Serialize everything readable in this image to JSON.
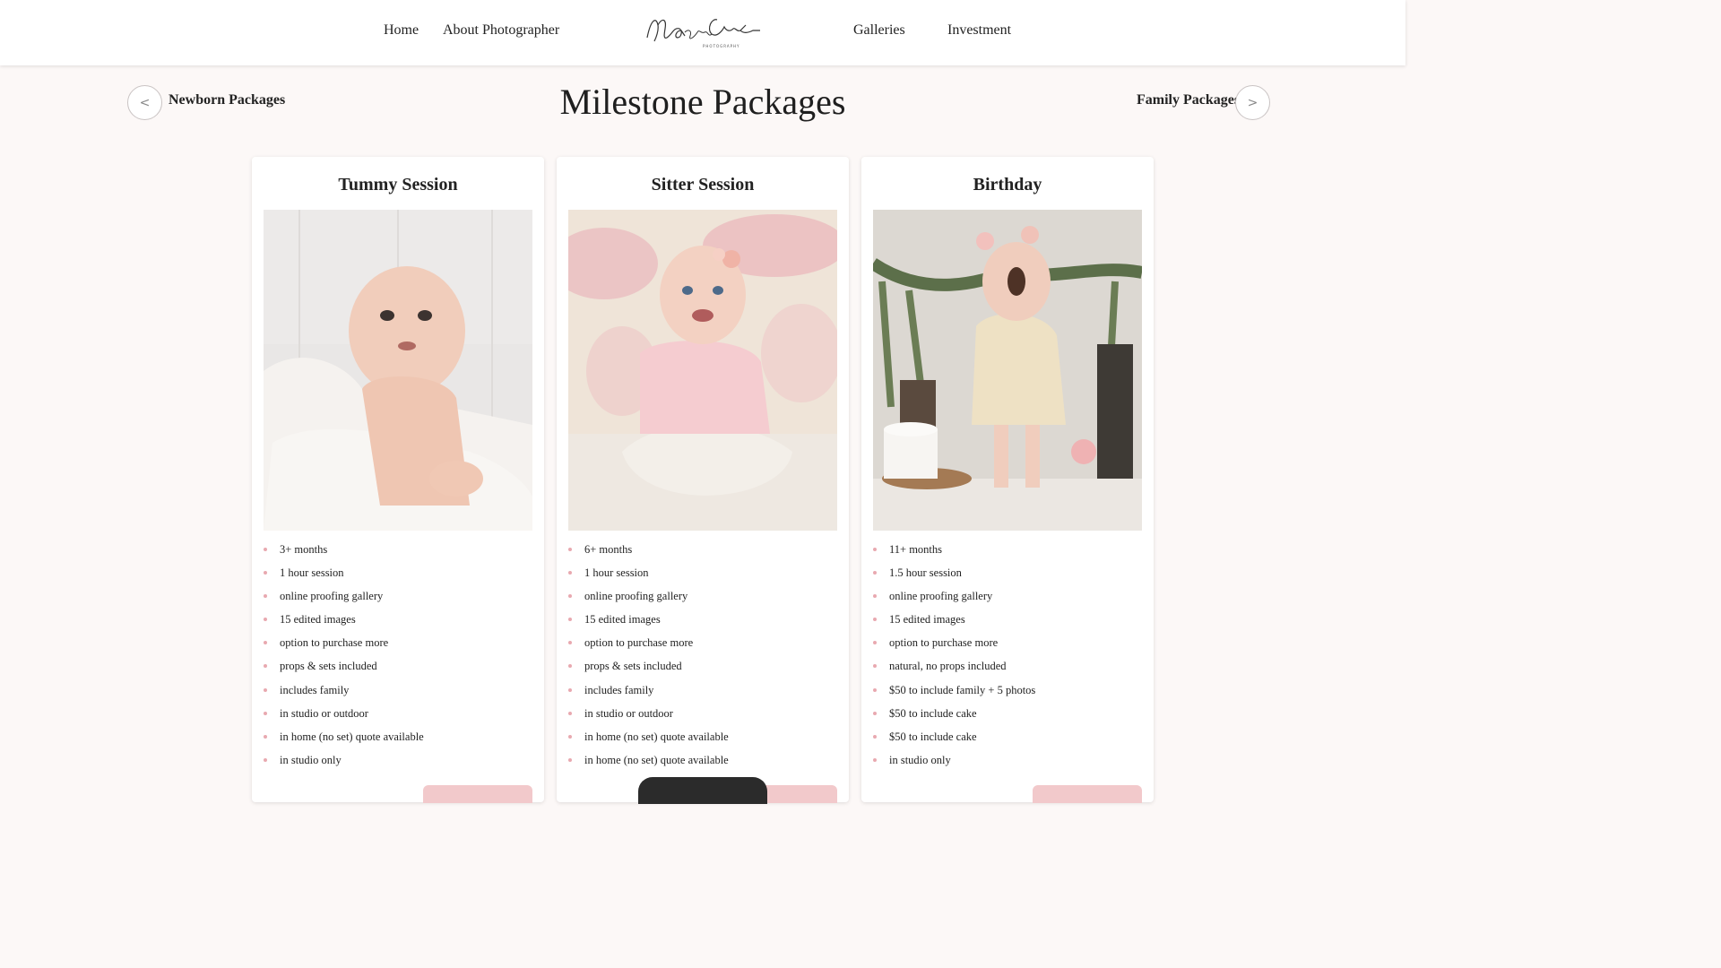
{
  "nav": {
    "home": "Home",
    "about": "About Photographer",
    "galleries": "Galleries",
    "investment": "Investment"
  },
  "logo": {
    "text": "Magnolia Coasts",
    "subtext": "PHOTOGRAPHY"
  },
  "subnav": {
    "prev_label": "Newborn Packages",
    "prev_icon": "<",
    "next_label": "Family Packages",
    "next_icon": ">"
  },
  "page_title": "Milestone Packages",
  "colors": {
    "accent": "#f2c9cb",
    "bullet": "#e8a9b0",
    "background": "#fcf8f7"
  },
  "cards": [
    {
      "title": "Tummy Session",
      "features": [
        "3+ months",
        "1 hour session",
        "online proofing gallery",
        "15 edited images",
        "option to purchase more",
        "props & sets included",
        "includes family",
        "in studio or outdoor",
        "in home (no set) quote available",
        "in studio only"
      ]
    },
    {
      "title": "Sitter Session",
      "features": [
        "6+ months",
        "1 hour session",
        "online proofing gallery",
        "15 edited images",
        "option to purchase more",
        "props & sets included",
        "includes family",
        "in studio or outdoor",
        "in home (no set) quote available",
        "in home (no set) quote available"
      ]
    },
    {
      "title": "Birthday",
      "features": [
        "11+ months",
        "1.5 hour session",
        "online proofing gallery",
        "15 edited images",
        "option to purchase more",
        "natural, no props included",
        "$50 to include family + 5 photos",
        "$50 to include cake",
        "$50 to include cake",
        "in studio only"
      ]
    }
  ]
}
